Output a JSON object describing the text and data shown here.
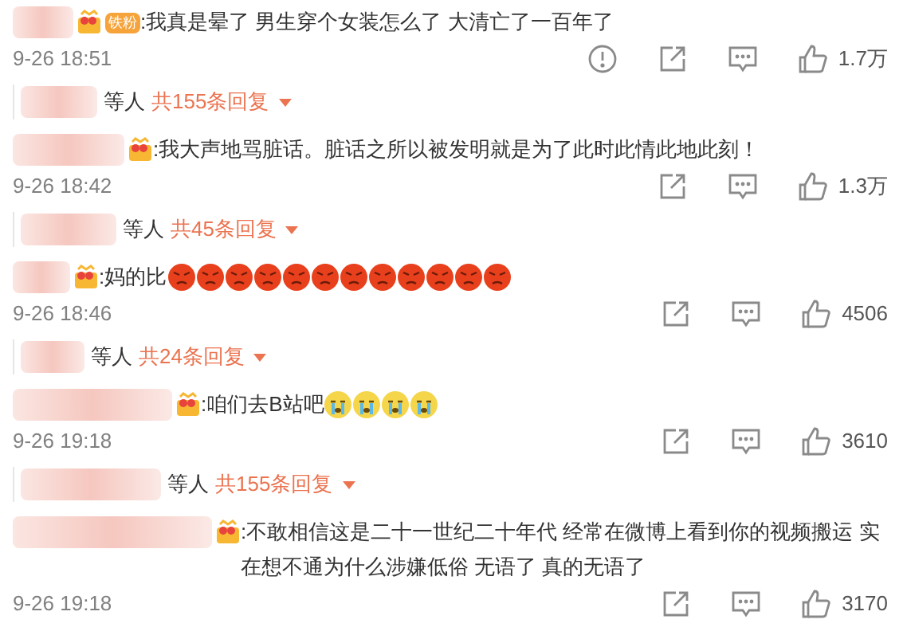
{
  "comments": [
    {
      "badge": "铁粉",
      "text": ":我真是晕了 男生穿个女装怎么了 大清亡了一百年了",
      "time": "9-26 18:51",
      "report": true,
      "likes": "1.7万",
      "replies": {
        "suffix": "等人",
        "count": "共155条回复"
      }
    },
    {
      "text": ":我大声地骂脏话。脏话之所以被发明就是为了此时此情此地此刻！",
      "time": "9-26 18:42",
      "report": false,
      "likes": "1.3万",
      "replies": {
        "suffix": "等人",
        "count": "共45条回复"
      }
    },
    {
      "text": ":妈的比",
      "emojis": [
        {
          "kind": "angry"
        },
        {
          "kind": "angry"
        },
        {
          "kind": "angry"
        },
        {
          "kind": "angry"
        },
        {
          "kind": "angry"
        },
        {
          "kind": "angry"
        },
        {
          "kind": "angry"
        },
        {
          "kind": "angry"
        },
        {
          "kind": "angry"
        },
        {
          "kind": "angry"
        },
        {
          "kind": "angry"
        },
        {
          "kind": "angry"
        }
      ],
      "time": "9-26 18:46",
      "report": false,
      "likes": "4506",
      "replies": {
        "suffix": "等人",
        "count": "共24条回复"
      }
    },
    {
      "text": ":咱们去B站吧",
      "emojis": [
        {
          "kind": "crying"
        },
        {
          "kind": "crying"
        },
        {
          "kind": "crying"
        },
        {
          "kind": "crying"
        }
      ],
      "time": "9-26 19:18",
      "report": false,
      "likes": "3610",
      "replies": {
        "suffix": "等人",
        "count": "共155条回复"
      }
    },
    {
      "text": ":不敢相信这是二十一世纪二十年代 经常在微博上看到你的视频搬运 实在想不通为什么涉嫌低俗 无语了 真的无语了",
      "time": "9-26 19:18",
      "report": false,
      "likes": "3170"
    }
  ]
}
